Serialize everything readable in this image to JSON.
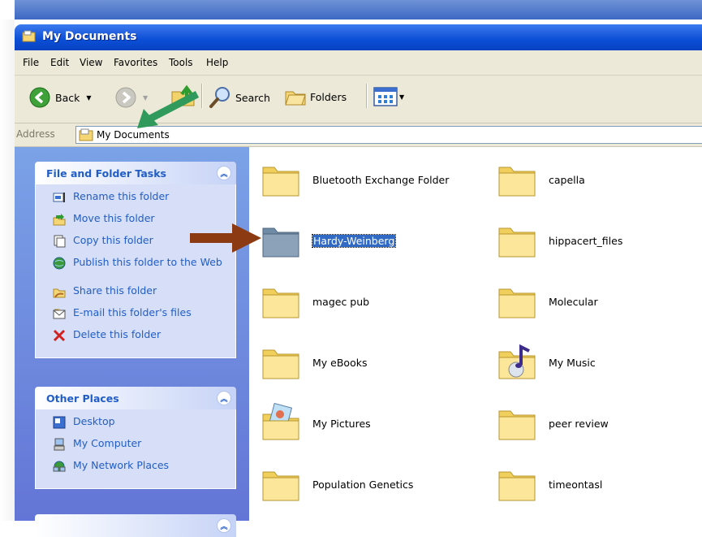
{
  "window": {
    "title": "My Documents"
  },
  "menu": [
    "File",
    "Edit",
    "View",
    "Favorites",
    "Tools",
    "Help"
  ],
  "toolbar": {
    "back_label": "Back",
    "search_label": "Search",
    "folders_label": "Folders"
  },
  "address": {
    "label": "Address",
    "value": "My Documents"
  },
  "file_tasks": {
    "title": "File and Folder Tasks",
    "items": [
      {
        "label": "Rename this folder",
        "icon": "rename-icon"
      },
      {
        "label": "Move this folder",
        "icon": "move-icon"
      },
      {
        "label": "Copy this folder",
        "icon": "copy-icon"
      },
      {
        "label": "Publish this folder to the Web",
        "icon": "publish-web-icon"
      },
      {
        "label": "Share this folder",
        "icon": "share-icon"
      },
      {
        "label": "E-mail this folder's files",
        "icon": "email-icon"
      },
      {
        "label": "Delete this folder",
        "icon": "delete-icon"
      }
    ]
  },
  "other_places": {
    "title": "Other Places",
    "items": [
      {
        "label": "Desktop",
        "icon": "desktop-icon"
      },
      {
        "label": "My Computer",
        "icon": "my-computer-icon"
      },
      {
        "label": "My Network Places",
        "icon": "network-places-icon"
      }
    ]
  },
  "files": [
    {
      "name": "Bluetooth Exchange Folder",
      "icon": "folder-icon",
      "selected": false
    },
    {
      "name": "capella",
      "icon": "folder-icon",
      "selected": false
    },
    {
      "name": "Hardy-Weinberg",
      "icon": "folder-icon",
      "selected": true
    },
    {
      "name": "hippacert_files",
      "icon": "folder-icon",
      "selected": false
    },
    {
      "name": "magec pub",
      "icon": "folder-icon",
      "selected": false
    },
    {
      "name": "Molecular",
      "icon": "folder-icon",
      "selected": false
    },
    {
      "name": "My eBooks",
      "icon": "folder-icon",
      "selected": false
    },
    {
      "name": "My Music",
      "icon": "music-folder-icon",
      "selected": false
    },
    {
      "name": "My Pictures",
      "icon": "pictures-folder-icon",
      "selected": false
    },
    {
      "name": "peer review",
      "icon": "folder-icon",
      "selected": false
    },
    {
      "name": "Population Genetics",
      "icon": "folder-icon",
      "selected": false
    },
    {
      "name": "timeontasl",
      "icon": "folder-icon",
      "selected": false
    }
  ],
  "colors": {
    "arrow_green": "#2f9a5c",
    "arrow_brown": "#8b3a12",
    "selection": "#316ac5",
    "title_blue": "#0a4ed6",
    "task_link": "#215dc6"
  }
}
